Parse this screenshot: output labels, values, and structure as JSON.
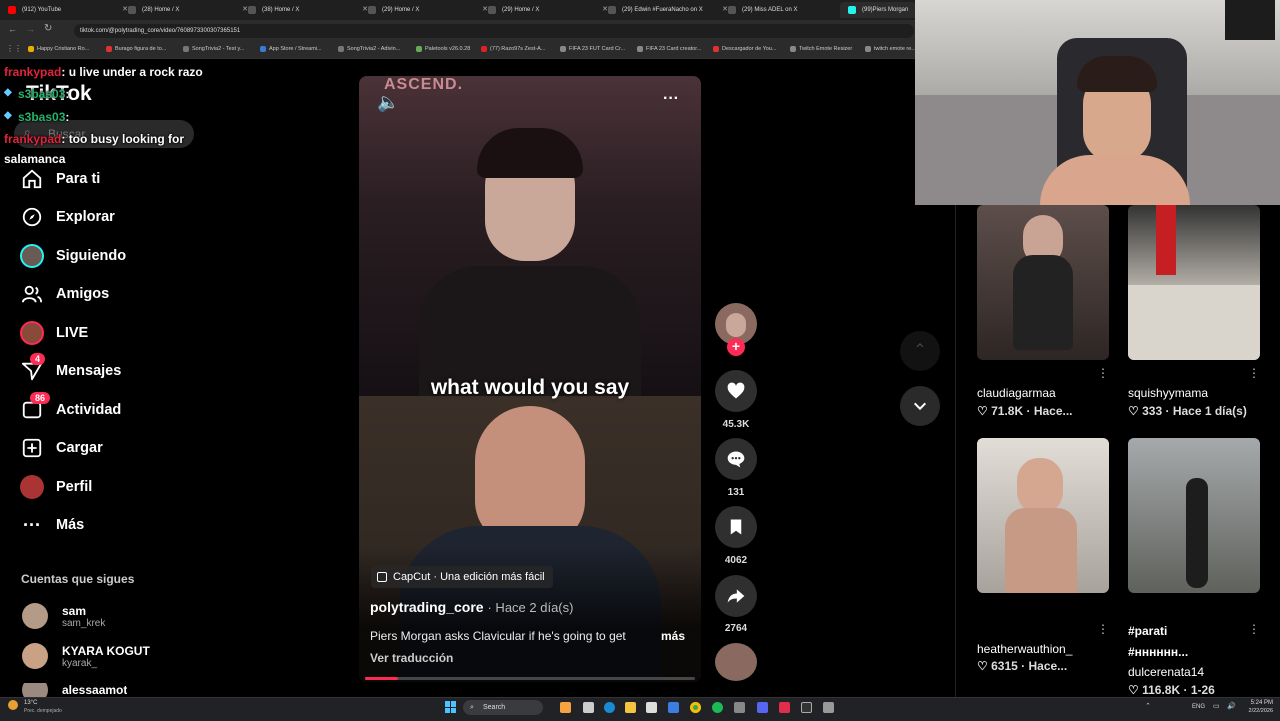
{
  "tabs": [
    {
      "title": "(912) YouTube",
      "color": "#ff0000"
    },
    {
      "title": "(28) Home / X",
      "color": "#888888"
    },
    {
      "title": "(38) Home / X",
      "color": "#888888"
    },
    {
      "title": "(29) Home / X",
      "color": "#888888"
    },
    {
      "title": "(29) Home / X",
      "color": "#888888"
    },
    {
      "title": "(29) Edwin #FueraNacho on X",
      "color": "#888888"
    },
    {
      "title": "(29) Miss ADEL on X",
      "color": "#888888"
    },
    {
      "title": "(99)Piers Morgan",
      "color": "#25f4ee"
    }
  ],
  "address": {
    "url": "tiktok.com/@polytrading_core/video/7608973300307365151"
  },
  "bookmarks": [
    "Happy Cristiano Ro...",
    "Burago figura de to...",
    "SongTrivia2 - Test y...",
    "App Store / Streami...",
    "SongTrivia2 - Adivin...",
    "Paletools v26.0.28",
    "(77) Razo97s Zest-A...",
    "FIFA 23 FUT Card Cr...",
    "FIFA 23 Card creator...",
    "Descargador de You...",
    "Twitch Emote Resizer",
    "twitch emote re..."
  ],
  "chat": [
    {
      "user": "frankypad",
      "msg": ": u live under a rock razo"
    },
    {
      "user": "s3bas03",
      "msg": ":"
    },
    {
      "user": "frankypad",
      "msg": ": too busy looking for"
    },
    {
      "user": "",
      "msg": "salamanca"
    }
  ],
  "brand": {
    "logo": "TikTok",
    "search_placeholder": "Buscar"
  },
  "nav": [
    {
      "label": "Para ti",
      "icon": "home-icon"
    },
    {
      "label": "Explorar",
      "icon": "compass-icon"
    },
    {
      "label": "Siguiendo",
      "icon": "following-avatar-icon"
    },
    {
      "label": "Amigos",
      "icon": "friends-icon"
    },
    {
      "label": "LIVE",
      "icon": "live-icon"
    },
    {
      "label": "Mensajes",
      "icon": "messages-icon",
      "badge": "4"
    },
    {
      "label": "Actividad",
      "icon": "activity-icon",
      "badge": "86"
    },
    {
      "label": "Cargar",
      "icon": "upload-icon"
    },
    {
      "label": "Perfil",
      "icon": "profile-icon"
    },
    {
      "label": "Más",
      "icon": "more-icon"
    }
  ],
  "following": {
    "heading": "Cuentas que sigues",
    "accounts": [
      {
        "name": "sam",
        "handle": "sam_krek"
      },
      {
        "name": "KYARA KOGUT",
        "handle": "kyarak_"
      },
      {
        "name": "alessaamot",
        "handle": ""
      }
    ]
  },
  "video": {
    "caption_overlay": "what would you say",
    "capcut": "CapCut · Una edición más fácil",
    "author": "polytrading_core",
    "time": "· Hace 2 día(s)",
    "description": "Piers Morgan asks Clavicular if he's going to get",
    "more": "más",
    "translate": "Ver traducción",
    "overlay_text": "ASCEND.",
    "progress": 0.1
  },
  "actions": {
    "likes": "45.3K",
    "comments": "131",
    "saves": "4062",
    "shares": "2764"
  },
  "grid": [
    {
      "name": "claudiagarmaa",
      "likes": "71.8K",
      "time": "Hace..."
    },
    {
      "name": "squishyymama",
      "likes": "333",
      "time": "Hace 1 día(s)"
    },
    {
      "name": "heatherwauthion_",
      "likes": "6315",
      "time": "Hace..."
    },
    {
      "name": "#parati",
      "tag2": "#нннннн...",
      "user": "dulcerenata14",
      "likes": "116.8K",
      "time": "1-26"
    }
  ],
  "taskbar": {
    "weather_temp": "13°C",
    "weather_desc": "Prec. dempejado",
    "search": "Search",
    "lang": "ENG",
    "time": "5:24 PM",
    "date": "2/22/2026"
  }
}
